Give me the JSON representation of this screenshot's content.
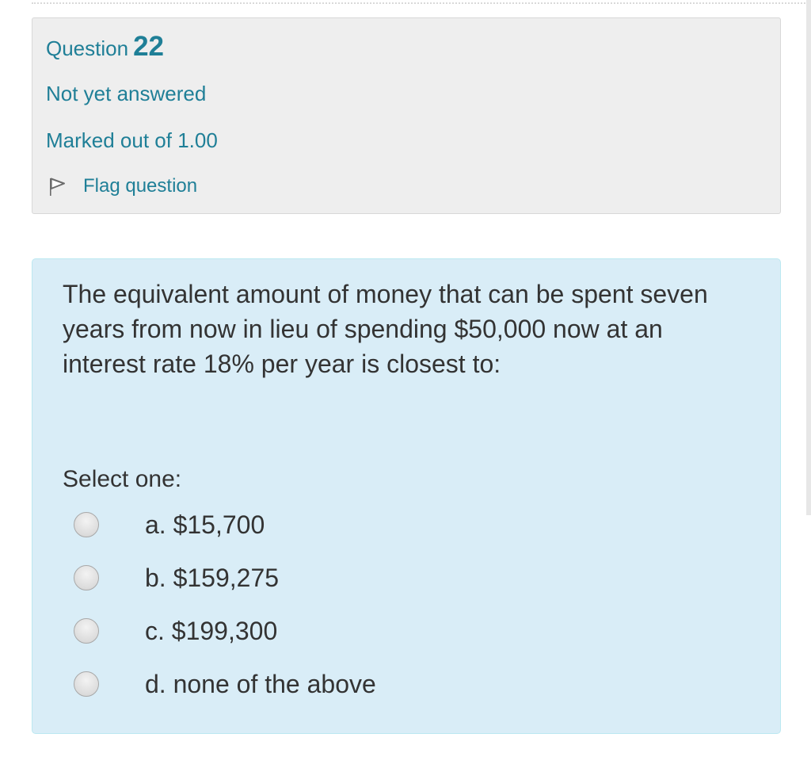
{
  "question": {
    "title_prefix": "Question",
    "number": "22",
    "state": "Not yet answered",
    "grade": "Marked out of 1.00",
    "flag_label": "Flag question",
    "text": "The equivalent amount of money that can be spent seven years from now in lieu of spending $50,000 now at an interest rate 18% per year is closest to:",
    "prompt": "Select one:",
    "answers": [
      {
        "label": "a. $15,700"
      },
      {
        "label": "b. $159,275"
      },
      {
        "label": "c. $199,300"
      },
      {
        "label": "d. none of the above"
      }
    ]
  },
  "icons": {
    "flag": "flag-icon",
    "radio": "radio-unchecked"
  },
  "colors": {
    "info_text": "#1f7f97",
    "info_bg": "#eeeeee",
    "content_bg": "#d9edf7",
    "content_border": "#bce8f1",
    "body_text": "#333333"
  }
}
